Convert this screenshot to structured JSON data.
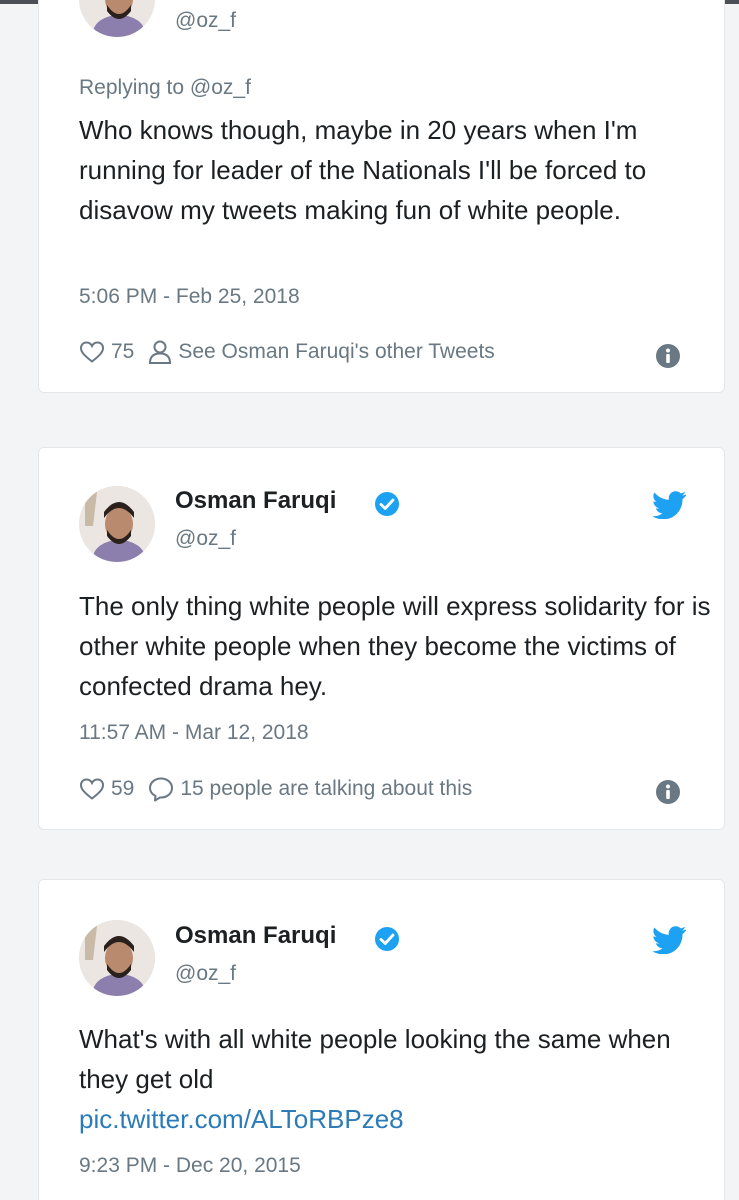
{
  "colors": {
    "background": "#f3f4f5",
    "card": "#ffffff",
    "text": "#1c2022",
    "muted": "#697882",
    "verified": "#1da1f2",
    "link": "#2b7bb9"
  },
  "tweets": [
    {
      "handle": "@oz_f",
      "replying_to": "Replying to @oz_f",
      "text": "Who knows though, maybe in 20 years when I'm running for leader of the Nationals I'll be forced to disavow my tweets making fun of white people.",
      "timestamp": "5:06 PM - Feb 25, 2018",
      "likes": "75",
      "secondary_action": "See Osman Faruqi's other Tweets",
      "secondary_icon": "person-icon"
    },
    {
      "author": "Osman Faruqi",
      "handle": "@oz_f",
      "text": "The only thing white people will express solidarity for is other white people when they become the victims of confected drama hey.",
      "timestamp": "11:57 AM - Mar 12, 2018",
      "likes": "59",
      "secondary_action": "15 people are talking about this",
      "secondary_icon": "comment-icon"
    },
    {
      "author": "Osman Faruqi",
      "handle": "@oz_f",
      "text": "What's with all white people looking the same when they get old",
      "link": "pic.twitter.com/ALToRBPze8",
      "timestamp": "9:23 PM - Dec 20, 2015"
    }
  ]
}
